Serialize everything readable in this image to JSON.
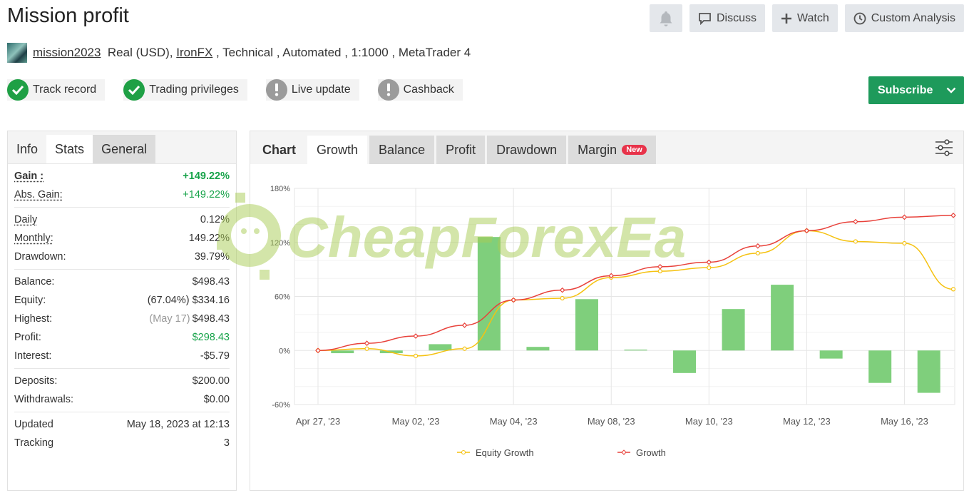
{
  "title": "Mission profit",
  "top_buttons": {
    "discuss": "Discuss",
    "watch": "Watch",
    "custom_analysis": "Custom Analysis"
  },
  "meta": {
    "user": "mission2023",
    "account": "Real (USD),",
    "broker": "IronFX",
    "rest": " , Technical , Automated , 1:1000 , MetaTrader 4"
  },
  "badges": [
    {
      "label": "Track record",
      "status": "ok"
    },
    {
      "label": "Trading privileges",
      "status": "ok"
    },
    {
      "label": "Live update",
      "status": "warn"
    },
    {
      "label": "Cashback",
      "status": "warn"
    }
  ],
  "subscribe": "Subscribe",
  "left_tabs": [
    "Info",
    "Stats",
    "General"
  ],
  "stats": {
    "gain_label": "Gain :",
    "gain": "+149.22%",
    "abs_gain_label": "Abs. Gain:",
    "abs_gain": "+149.22%",
    "daily_label": "Daily",
    "daily": "0.12%",
    "monthly_label": "Monthly:",
    "monthly": "149.22%",
    "drawdown_label": "Drawdown:",
    "drawdown": "39.79%",
    "balance_label": "Balance:",
    "balance": "$498.43",
    "equity_label": "Equity:",
    "equity_pct": "(67.04%)",
    "equity": "$334.16",
    "highest_label": "Highest:",
    "highest_date": "(May 17)",
    "highest": "$498.43",
    "profit_label": "Profit:",
    "profit": "$298.43",
    "interest_label": "Interest:",
    "interest": "-$5.79",
    "deposits_label": "Deposits:",
    "deposits": "$200.00",
    "withdrawals_label": "Withdrawals:",
    "withdrawals": "$0.00",
    "updated_label": "Updated",
    "updated": "May 18, 2023 at 12:13",
    "tracking_label": "Tracking",
    "tracking": "3"
  },
  "chart_tabs": {
    "label": "Chart",
    "growth": "Growth",
    "balance": "Balance",
    "profit": "Profit",
    "drawdown": "Drawdown",
    "margin": "Margin",
    "new_badge": "New"
  },
  "watermark": "CheapForexEa",
  "colors": {
    "accent_green": "#1e9a5b",
    "bar": "#7fcf7c",
    "growth_line": "#e8413a",
    "equity_line": "#f5c211"
  },
  "chart_data": {
    "type": "bar+line",
    "x_labels": [
      "Apr 27, '23",
      "May 02, '23",
      "May 04, '23",
      "May 08, '23",
      "May 10, '23",
      "May 12, '23",
      "May 16, '23"
    ],
    "ylim": [
      -60,
      180
    ],
    "y_ticks": [
      "-60%",
      "0%",
      "60%",
      "120%",
      "180%"
    ],
    "y_tick_values": [
      -60,
      0,
      60,
      120,
      180
    ],
    "bars": [
      -3,
      -3,
      7,
      126,
      4,
      57,
      1,
      -25,
      46,
      73,
      -9,
      -36,
      -47
    ],
    "series": [
      {
        "name": "Equity Growth",
        "values": [
          0,
          2,
          -6,
          2,
          56,
          58,
          81,
          88,
          92,
          108,
          133,
          121,
          119,
          68
        ]
      },
      {
        "name": "Growth",
        "values": [
          0,
          8,
          16,
          28,
          56,
          67,
          83,
          93,
          98,
          116,
          133,
          143,
          148,
          150
        ]
      }
    ],
    "legend": "bottom"
  }
}
